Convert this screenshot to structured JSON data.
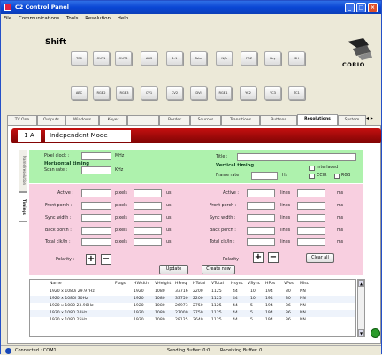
{
  "window": {
    "title": "C2 Control Panel"
  },
  "menu": [
    "File",
    "Communications",
    "Tools",
    "Resolution",
    "Help"
  ],
  "toolbar": {
    "shift_label": "Shift",
    "row1": [
      "TC0",
      "OUT1",
      "OUT3",
      "ABS",
      "1:1",
      "Take",
      "N/A",
      "FRZ",
      "Key",
      "SH"
    ],
    "row2": [
      "ABC",
      "RGB2",
      "RGB3",
      "CV1",
      "CV2",
      "DVI",
      "RGB1",
      "YC2",
      "YC3",
      "TC1"
    ],
    "logo_text": "CORIO"
  },
  "tabs": [
    "TV One",
    "Outputs",
    "Windows",
    "Keyer",
    "",
    "Border",
    "Sources",
    "Transitions",
    "Buttons",
    "Resolutions",
    "System"
  ],
  "active_tab": "Resolutions",
  "mode": {
    "id": "1 A",
    "name": "Independent Mode"
  },
  "side_tabs": [
    "Name/resolution",
    "Timings"
  ],
  "green": {
    "pixel_clock": "Pixel clock :",
    "mhz": "MHz",
    "h_heading": "Horizontal timing",
    "scan_rate": "Scan rate :",
    "khz": "KHz",
    "title": "Title :",
    "v_heading": "Vertical timing",
    "frame_rate": "Frame rate :",
    "hz": "Hz",
    "interlaced": "Interlaced",
    "ccir": "CCIR",
    "rgb": "RGB"
  },
  "pink": {
    "rows": [
      "Active :",
      "Front porch :",
      "Sync width :",
      "Back porch :",
      "Total clk/ln :"
    ],
    "h_unit": "pixels",
    "v_unit": "lines",
    "us": "us",
    "ms": "ms",
    "polarity": "Polarity :",
    "plus": "+",
    "minus": "−",
    "update": "Update",
    "create_new": "Create new",
    "clear_all": "Clear all"
  },
  "table": {
    "headers": [
      "Name",
      "Flags",
      "HWidth",
      "VHeight",
      "HFreq",
      "HTotal",
      "VTotal",
      "Hsync",
      "VSync",
      "HPos",
      "VPos",
      "Misc"
    ],
    "rows": [
      [
        "1920 x 1080i 29.97Hz",
        "I",
        "1920",
        "1080",
        "33716",
        "2200",
        "1125",
        "44",
        "10",
        "194",
        "30",
        "NN"
      ],
      [
        "1920 x 1080i 30Hz",
        "I",
        "1920",
        "1080",
        "33750",
        "2200",
        "1125",
        "44",
        "10",
        "194",
        "30",
        "NN"
      ],
      [
        "1920 x 1080 23.98Hz",
        "",
        "1920",
        "1080",
        "26973",
        "2750",
        "1125",
        "44",
        "5",
        "194",
        "36",
        "NN"
      ],
      [
        "1920 x 1080 24Hz",
        "",
        "1920",
        "1080",
        "27000",
        "2750",
        "1125",
        "44",
        "5",
        "194",
        "36",
        "NN"
      ],
      [
        "1920 x 1080 25Hz",
        "",
        "1920",
        "1080",
        "28125",
        "2640",
        "1125",
        "44",
        "5",
        "194",
        "36",
        "NN"
      ]
    ]
  },
  "status": {
    "connected": "Connected : COM1",
    "send": "Sending Buffer: 0:0",
    "recv": "Receiving Buffer: 0"
  }
}
